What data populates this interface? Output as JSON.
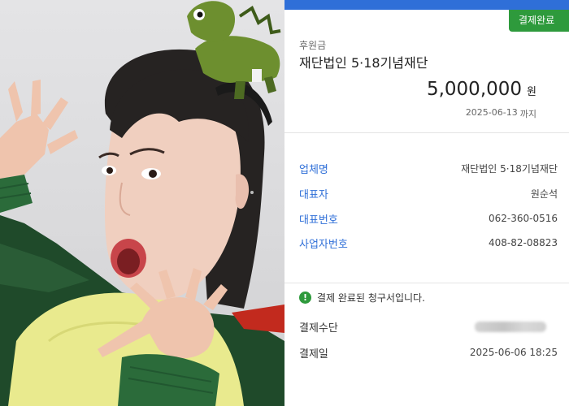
{
  "photo": {
    "alt": ""
  },
  "receipt": {
    "status_button": "결제완료",
    "category": "후원금",
    "organization": "재단법인 5·18기념재단",
    "amount": "5,000,000",
    "currency": "원",
    "due_date": "2025-06-13",
    "due_suffix": "까지",
    "details": [
      {
        "label": "업체명",
        "value": "재단법인 5·18기념재단"
      },
      {
        "label": "대표자",
        "value": "원순석"
      },
      {
        "label": "대표번호",
        "value": "062-360-0516"
      },
      {
        "label": "사업자번호",
        "value": "408-82-08823"
      }
    ],
    "notice": "결제 완료된 청구서입니다.",
    "payment_method_label": "결제수단",
    "payment_date_label": "결제일",
    "payment_date": "2025-06-06 18:25"
  },
  "colors": {
    "header_blue": "#2f6fd8",
    "label_blue": "#2f6fd8",
    "status_green": "#2e9a3c"
  }
}
